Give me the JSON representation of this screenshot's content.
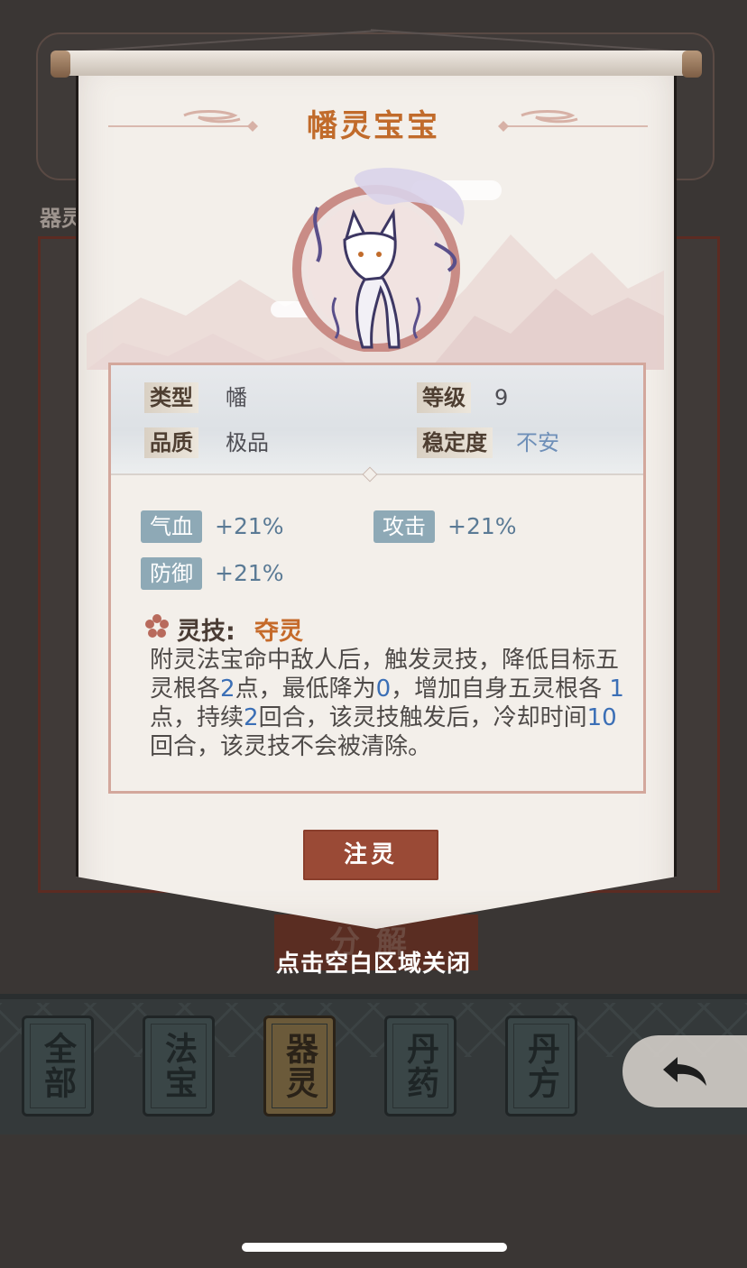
{
  "background": {
    "section_label": "器灵",
    "decompose_label": "分解",
    "close_hint": "点击空白区域关闭",
    "tabs": [
      {
        "label": "全部",
        "active": false
      },
      {
        "label": "法宝",
        "active": false
      },
      {
        "label": "器灵",
        "active": true
      },
      {
        "label": "丹药",
        "active": false
      },
      {
        "label": "丹方",
        "active": false
      }
    ],
    "back_icon": "back-arrow-icon"
  },
  "modal": {
    "title": "幡灵宝宝",
    "portrait_icon": "spirit-fox-icon",
    "info": {
      "type_key": "类型",
      "type_value": "幡",
      "level_key": "等级",
      "level_value": "9",
      "quality_key": "品质",
      "quality_value": "极品",
      "stability_key": "稳定度",
      "stability_value": "不安"
    },
    "stats": [
      {
        "name": "气血",
        "value": "+21%"
      },
      {
        "name": "攻击",
        "value": "+21%"
      },
      {
        "name": "防御",
        "value": "+21%"
      }
    ],
    "skill": {
      "icon": "flower-icon",
      "label": "灵技:",
      "name": "夺灵",
      "desc_parts": [
        "附灵法宝命中敌人后，触发灵技，降低目标五灵根各",
        "2",
        "点，最低降为",
        "0",
        "，增加自身五灵根各 ",
        "1",
        " 点，持续",
        "2",
        "回合，该灵技触发后，冷却时间",
        "10",
        "回合，该灵技不会被清除。"
      ]
    },
    "inject_button": "注灵"
  },
  "colors": {
    "title": "#c16b2b",
    "skill_name": "#c56a2a",
    "stat_tag_bg": "#8ea9b6",
    "number_highlight": "#3b6fb6",
    "button_bg": "#9a4a36",
    "unstable": "#6e8fb8"
  }
}
